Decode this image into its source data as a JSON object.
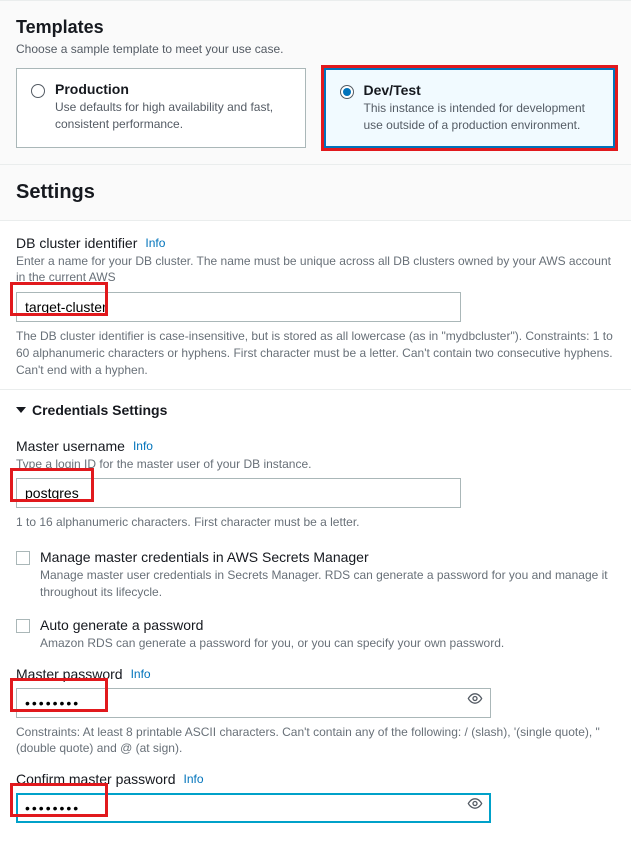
{
  "templates": {
    "title": "Templates",
    "subtitle": "Choose a sample template to meet your use case.",
    "production": {
      "title": "Production",
      "desc": "Use defaults for high availability and fast, consistent performance."
    },
    "devtest": {
      "title": "Dev/Test",
      "desc": "This instance is intended for development use outside of a production environment."
    }
  },
  "settings": {
    "heading": "Settings"
  },
  "cluster_id": {
    "label": "DB cluster identifier",
    "info": "Info",
    "help": "Enter a name for your DB cluster. The name must be unique across all DB clusters owned by your AWS account in the current AWS",
    "value": "target-cluster",
    "constraints": "The DB cluster identifier is case-insensitive, but is stored as all lowercase (as in \"mydbcluster\"). Constraints: 1 to 60 alphanumeric characters or hyphens. First character must be a letter. Can't contain two consecutive hyphens. Can't end with a hyphen."
  },
  "credentials": {
    "heading": "Credentials Settings"
  },
  "master_user": {
    "label": "Master username",
    "info": "Info",
    "help": "Type a login ID for the master user of your DB instance.",
    "value": "postgres",
    "constraints": "1 to 16 alphanumeric characters. First character must be a letter."
  },
  "secrets_mgr": {
    "label": "Manage master credentials in AWS Secrets Manager",
    "desc": "Manage master user credentials in Secrets Manager. RDS can generate a password for you and manage it throughout its lifecycle."
  },
  "autogen": {
    "label": "Auto generate a password",
    "desc": "Amazon RDS can generate a password for you, or you can specify your own password."
  },
  "master_pw": {
    "label": "Master password",
    "info": "Info",
    "value": "••••••••",
    "constraints": "Constraints: At least 8 printable ASCII characters. Can't contain any of the following: / (slash), '(single quote), \"(double quote) and @ (at sign)."
  },
  "confirm_pw": {
    "label": "Confirm master password",
    "info": "Info",
    "value": "••••••••"
  }
}
